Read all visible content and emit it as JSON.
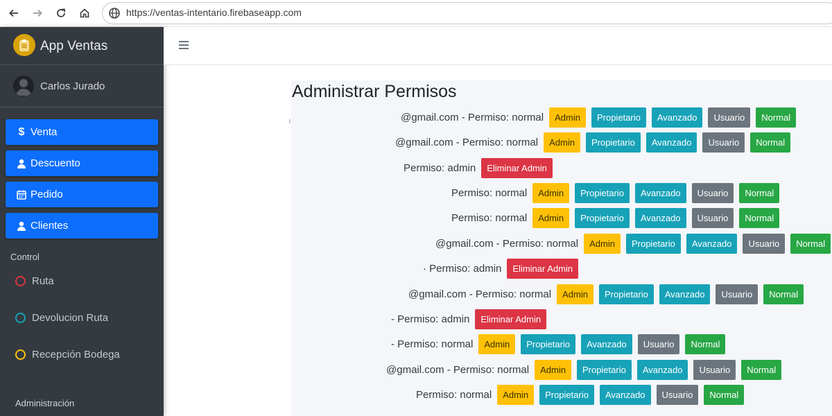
{
  "browser": {
    "url": "https://ventas-intentario.firebaseapp.com"
  },
  "sidebar": {
    "brand": "App Ventas",
    "user": "Carlos Jurado",
    "menu": [
      {
        "label": "Venta",
        "icon": "dollar-icon"
      },
      {
        "label": "Descuento",
        "icon": "user-icon"
      },
      {
        "label": "Pedido",
        "icon": "calendar-icon"
      },
      {
        "label": "Clientes",
        "icon": "user-icon"
      }
    ],
    "control_header": "Control",
    "control_items": [
      {
        "label": "Ruta",
        "color": "#dc3545"
      },
      {
        "label": "Devolucion Ruta",
        "color": "#17a2b8"
      },
      {
        "label": "Recepción Bodega",
        "color": "#ffc107"
      }
    ],
    "admin_header": "Administración"
  },
  "main": {
    "title": "Administrar Permisos",
    "buttons": {
      "admin": "Admin",
      "propietario": "Propietario",
      "avanzado": "Avanzado",
      "usuario": "Usuario",
      "normal": "Normal",
      "eliminar": "Eliminar Admin"
    },
    "rows": [
      {
        "text": "@gmail.com - Permiso: normal",
        "type": "normal"
      },
      {
        "text": "@gmail.com - Permiso: normal",
        "type": "normal"
      },
      {
        "text": "Permiso: admin",
        "type": "admin"
      },
      {
        "text": "Permiso: normal",
        "type": "normal"
      },
      {
        "text": "Permiso: normal",
        "type": "normal"
      },
      {
        "text": "@gmail.com - Permiso: normal",
        "type": "normal"
      },
      {
        "text": "· Permiso: admin",
        "type": "admin"
      },
      {
        "text": "@gmail.com - Permiso: normal",
        "type": "normal"
      },
      {
        "text": "- Permiso: admin",
        "type": "admin"
      },
      {
        "text": "- Permiso: normal",
        "type": "normal"
      },
      {
        "text": "@gmail.com - Permiso: normal",
        "type": "normal"
      },
      {
        "text": "Permiso: normal",
        "type": "normal"
      }
    ]
  }
}
